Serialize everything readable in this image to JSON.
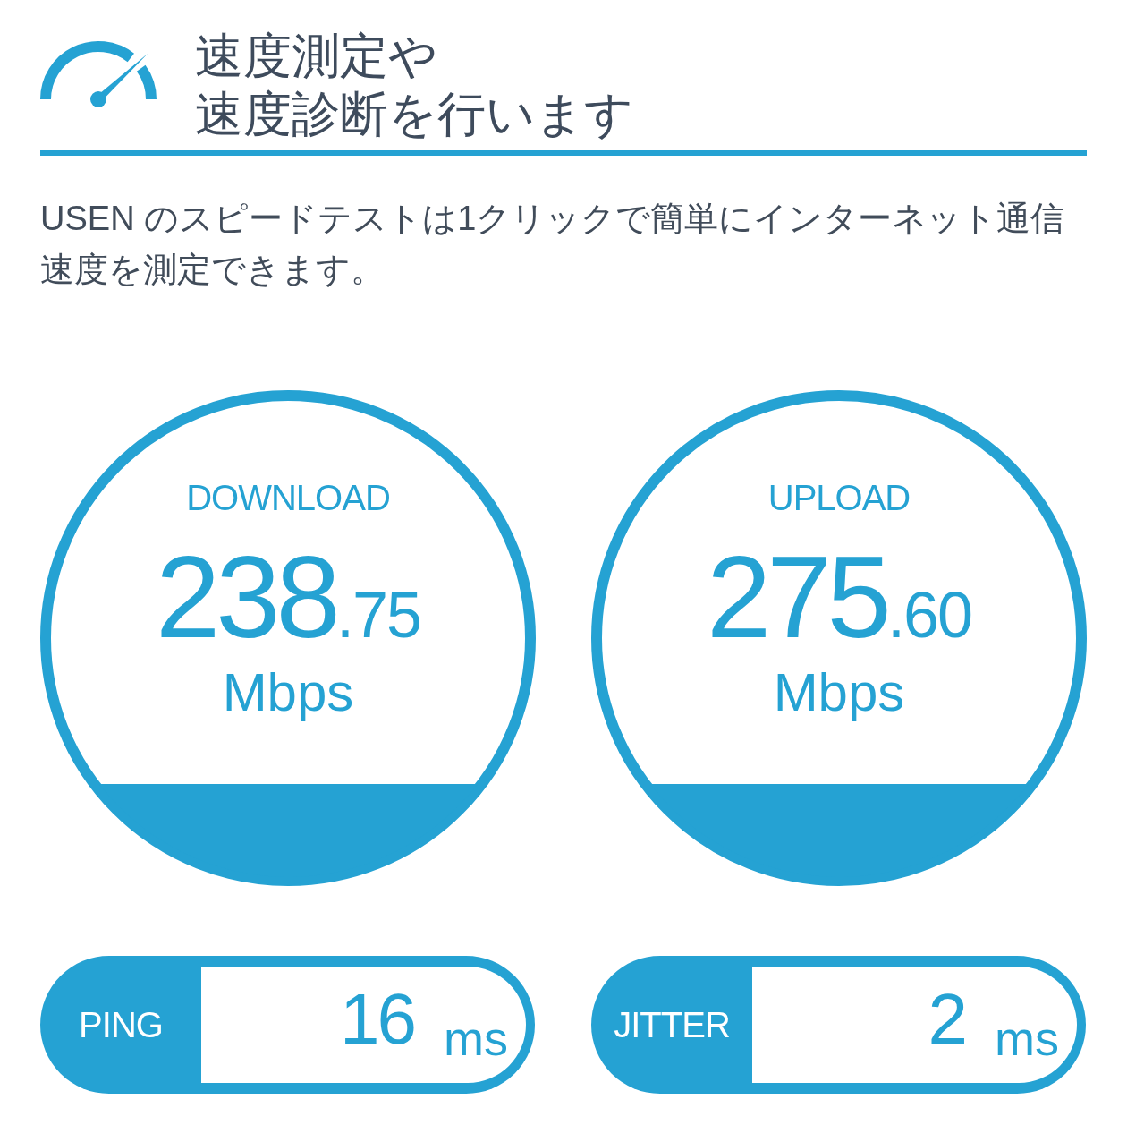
{
  "header": {
    "title_lines": [
      "速度測定や",
      "速度診断を行います"
    ]
  },
  "description": "USEN のスピードテストは1クリックで簡単にインターネット通信速度を測定できます。",
  "gauges": [
    {
      "label": "DOWNLOAD",
      "value_whole": "238",
      "value_fraction": ".75",
      "unit": "Mbps"
    },
    {
      "label": "UPLOAD",
      "value_whole": "275",
      "value_fraction": ".60",
      "unit": "Mbps"
    }
  ],
  "stats": [
    {
      "label": "PING",
      "value": "16",
      "unit": "ms"
    },
    {
      "label": "JITTER",
      "value": "2",
      "unit": "ms"
    }
  ]
}
